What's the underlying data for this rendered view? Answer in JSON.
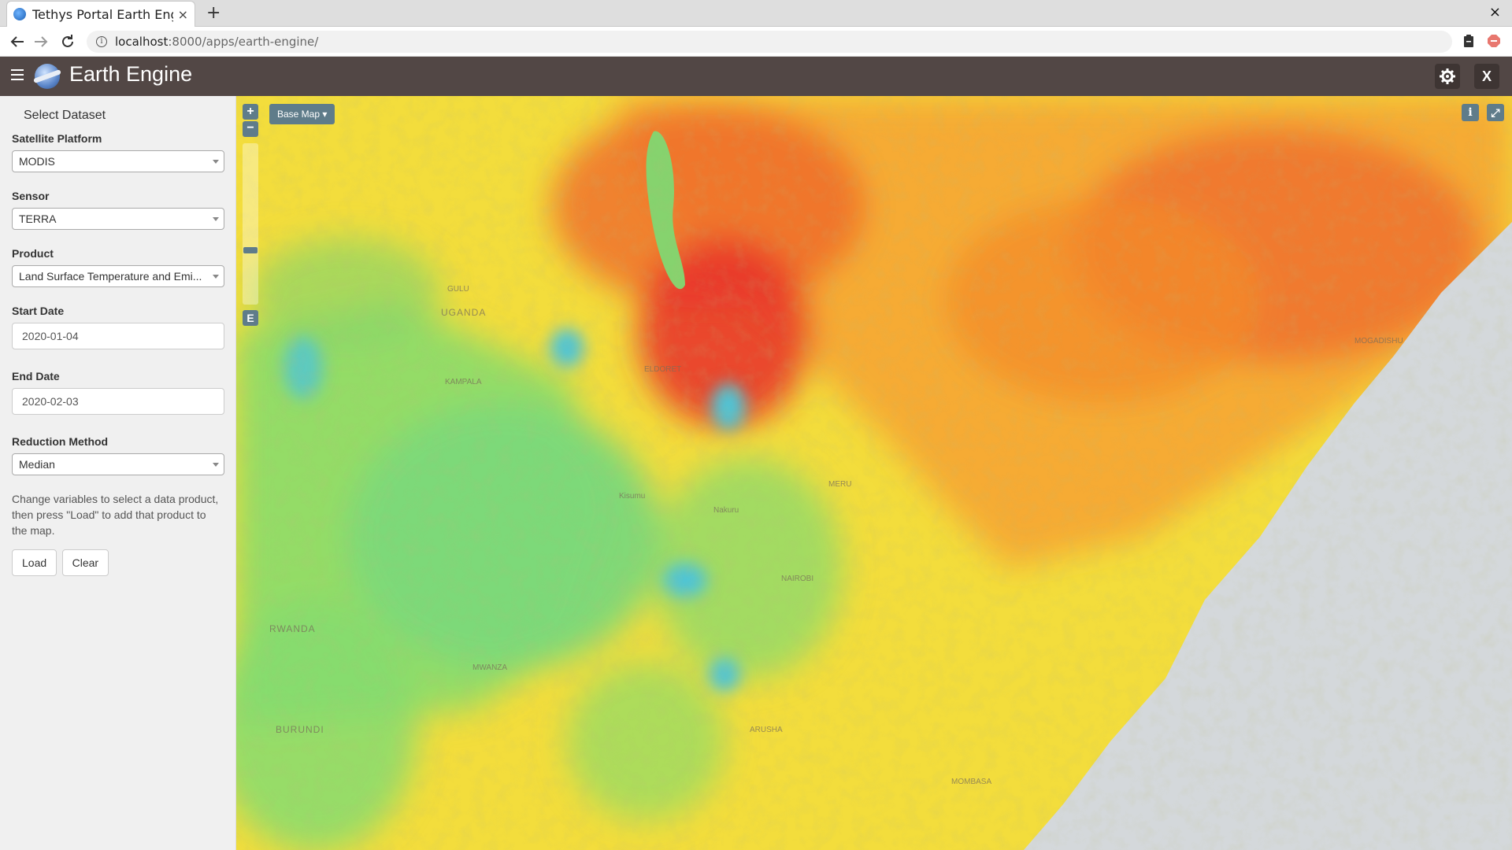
{
  "browser": {
    "tab_title": "Tethys Portal Earth Eng",
    "tab_close": "×",
    "new_tab": "+",
    "window_close": "×",
    "url_host": "localhost",
    "url_path": ":8000/apps/earth-engine/"
  },
  "app": {
    "title": "Earth Engine",
    "close_label": "X"
  },
  "sidebar": {
    "heading": "Select Dataset",
    "fields": {
      "platform": {
        "label": "Satellite Platform",
        "value": "MODIS"
      },
      "sensor": {
        "label": "Sensor",
        "value": "TERRA"
      },
      "product": {
        "label": "Product",
        "value": "Land Surface Temperature and Emi..."
      },
      "start_date": {
        "label": "Start Date",
        "value": "2020-01-04"
      },
      "end_date": {
        "label": "End Date",
        "value": "2020-02-03"
      },
      "reduction": {
        "label": "Reduction Method",
        "value": "Median"
      }
    },
    "help_text": "Change variables to select a data product, then press \"Load\" to add that product to the map.",
    "load_label": "Load",
    "clear_label": "Clear"
  },
  "map": {
    "zoom_in": "+",
    "zoom_out": "−",
    "extent_label": "E",
    "basemap_label": "Base Map ▾",
    "info_label": "i",
    "fullscreen_label": "⤢",
    "place_labels": [
      {
        "text": "UGANDA",
        "big": true
      },
      {
        "text": "KAMPALA",
        "big": false
      },
      {
        "text": "ELDORET",
        "big": false
      },
      {
        "text": "MERU",
        "big": false
      },
      {
        "text": "NAIROBI",
        "big": false
      },
      {
        "text": "RWANDA",
        "big": true
      },
      {
        "text": "BURUNDI",
        "big": true
      },
      {
        "text": "MWANZA",
        "big": false
      },
      {
        "text": "ARUSHA",
        "big": false
      },
      {
        "text": "MOMBASA",
        "big": false
      },
      {
        "text": "MOGADISHU",
        "big": false
      },
      {
        "text": "GULU",
        "big": false
      },
      {
        "text": "Kisumu",
        "big": false
      },
      {
        "text": "Nakuru",
        "big": false
      }
    ],
    "colors": {
      "hot": "#e8302a",
      "warm": "#f39a2a",
      "mid": "#f5e23a",
      "cool": "#7ddc6e",
      "cold": "#4fc4d6",
      "ocean": "#d4d8db"
    }
  }
}
